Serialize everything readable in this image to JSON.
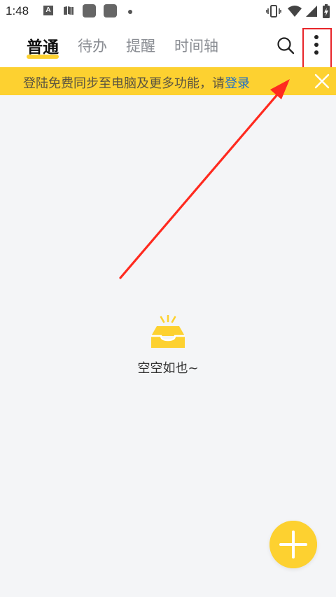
{
  "status_bar": {
    "time": "1:48",
    "icons": [
      "a-notification-icon",
      "book-icon",
      "app-icon",
      "app-icon",
      "dot-icon",
      "vibrate-icon",
      "wifi-icon",
      "signal-icon",
      "battery-charging-icon"
    ],
    "a_glyph": "A"
  },
  "tabs": [
    {
      "label": "普通",
      "active": true
    },
    {
      "label": "待办",
      "active": false
    },
    {
      "label": "提醒",
      "active": false
    },
    {
      "label": "时间轴",
      "active": false
    }
  ],
  "toolbar": {
    "search_icon": "search-icon",
    "more_icon": "more-vertical-icon"
  },
  "banner": {
    "text": "登陆免费同步至电脑及更多功能，请",
    "link": "登录",
    "close_icon": "close-icon"
  },
  "empty_state": {
    "icon": "empty-inbox-icon",
    "text": "空空如也~"
  },
  "fab": {
    "icon": "plus-icon"
  },
  "colors": {
    "accent": "#fdd130",
    "link": "#1e6fc8",
    "annotation": "#e8262a",
    "background": "#f4f5f7"
  }
}
